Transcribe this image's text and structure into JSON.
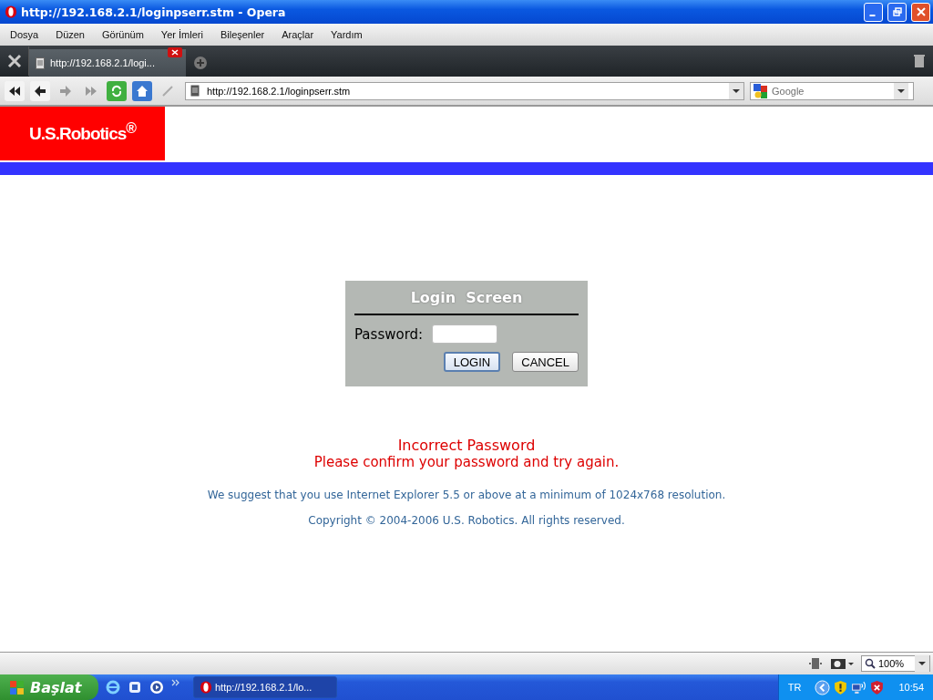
{
  "window": {
    "title": "http://192.168.2.1/loginpserr.stm - Opera"
  },
  "menu": [
    "Dosya",
    "Düzen",
    "Görünüm",
    "Yer İmleri",
    "Bileşenler",
    "Araçlar",
    "Yardım"
  ],
  "tabs": [
    {
      "label": "http://192.168.2.1/logi...",
      "selected": true
    }
  ],
  "address": {
    "value": "http://192.168.2.1/loginpserr.stm"
  },
  "search": {
    "placeholder": "Google"
  },
  "page": {
    "logo": "U.S.Robotics$^{®}$",
    "login": {
      "title": "Login  Screen",
      "password_label": "Password:",
      "buttons": [
        {
          "label": "LOGIN",
          "kind": "default"
        },
        {
          "label": "CANCEL",
          "kind": "normal"
        }
      ]
    },
    "error_title": "Incorrect Password",
    "error_message": "Please confirm your password and try again.",
    "suggestion": "We suggest that you use Internet Explorer 5.5 or above at a minimum of 1024x768 resolution.",
    "copyright": "Copyright © 2004-2006 U.S. Robotics. All rights reserved."
  },
  "status_bar": {
    "zoom": "100%"
  },
  "taskbar": {
    "start": "Başlat",
    "tasks": [
      {
        "label": "http://192.168.2.1/lo...",
        "selected": true
      }
    ],
    "language": "TR",
    "clock": "10:54"
  }
}
